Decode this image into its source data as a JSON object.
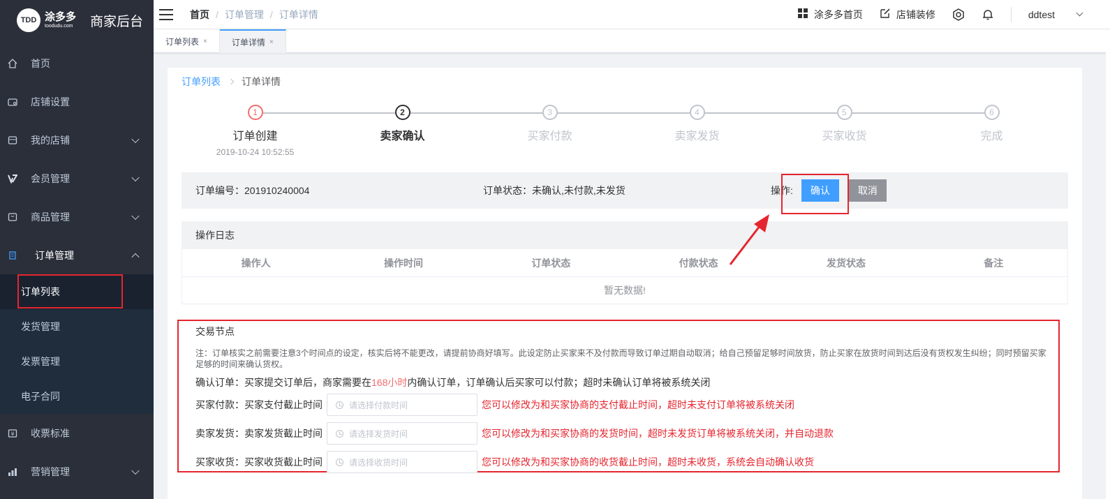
{
  "sidebar": {
    "logo_mark": "TDD",
    "logo_brand": "涂多多",
    "logo_domain": "toodudu.com",
    "title": "商家后台",
    "menu": [
      {
        "label": "首页"
      },
      {
        "label": "店铺设置"
      },
      {
        "label": "我的店铺"
      },
      {
        "label": "会员管理"
      },
      {
        "label": "商品管理"
      },
      {
        "label": "订单管理"
      }
    ],
    "submenu": [
      {
        "label": "订单列表"
      },
      {
        "label": "发货管理"
      },
      {
        "label": "发票管理"
      },
      {
        "label": "电子合同"
      }
    ],
    "menu_after": [
      {
        "label": "收票标准"
      },
      {
        "label": "营销管理"
      }
    ]
  },
  "topbar": {
    "breadcrumb": [
      "首页",
      "订单管理",
      "订单详情"
    ],
    "home_link": "涂多多首页",
    "decorate_link": "店铺装修",
    "username": "ddtest"
  },
  "tabs": [
    {
      "label": "订单列表",
      "close": "×"
    },
    {
      "label": "订单详情",
      "close": "×"
    }
  ],
  "page": {
    "breadcrumb_link": "订单列表",
    "breadcrumb_current": "订单详情"
  },
  "steps": [
    {
      "num": "1",
      "title": "订单创建",
      "desc": "2019-10-24 10:52:55",
      "status": "done"
    },
    {
      "num": "2",
      "title": "卖家确认",
      "desc": "",
      "status": "process"
    },
    {
      "num": "3",
      "title": "买家付款",
      "desc": "",
      "status": "wait"
    },
    {
      "num": "4",
      "title": "卖家发货",
      "desc": "",
      "status": "wait"
    },
    {
      "num": "5",
      "title": "买家收货",
      "desc": "",
      "status": "wait"
    },
    {
      "num": "6",
      "title": "完成",
      "desc": "",
      "status": "wait"
    }
  ],
  "order": {
    "number_label": "订单编号：",
    "number": "201910240004",
    "status_label": "订单状态：",
    "status": "未确认,未付款,未发货",
    "op_label": "操作:",
    "confirm_button": "确认",
    "cancel_button": "取消"
  },
  "log": {
    "title": "操作日志",
    "columns": [
      "操作人",
      "操作时间",
      "订单状态",
      "付款状态",
      "发货状态",
      "备注"
    ],
    "empty_text": "暂无数据!"
  },
  "nodes": {
    "title": "交易节点",
    "note": "注：订单核实之前需要注意3个时间点的设定，核实后将不能更改，请提前协商好填写。此设定防止买家来不及付款而导致订单过期自动取消；给自己预留足够时间放货，防止买家在放货时间到达后没有货权发生纠纷；同时预留买家足够的时间来确认货权。",
    "confirm_prefix": "确认订单：买家提交订单后，商家需要在",
    "confirm_hours": "168小时",
    "confirm_suffix": "内确认订单，订单确认后买家可以付款；超时未确认订单将被系统关闭",
    "rows": [
      {
        "label": "买家付款：买家支付截止时间",
        "placeholder": "请选择付款时间",
        "hint": "您可以修改为和买家协商的支付截止时间，超时未支付订单将被系统关闭"
      },
      {
        "label": "卖家发货：卖家发货截止时间",
        "placeholder": "请选择发货时间",
        "hint": "您可以修改为和买家协商的发货时间，超时未发货订单将被系统关闭，并自动退款"
      },
      {
        "label": "买家收货：买家收货截止时间",
        "placeholder": "请选择收货时间",
        "hint": "您可以修改为和买家协商的收货截止时间，超时未收货，系统会自动确认收货"
      }
    ]
  },
  "colors": {
    "sidebar_bg": "#2b2f3a",
    "primary": "#409eff",
    "annotation_red": "#e5252e",
    "step_done": "#f56c6c"
  }
}
